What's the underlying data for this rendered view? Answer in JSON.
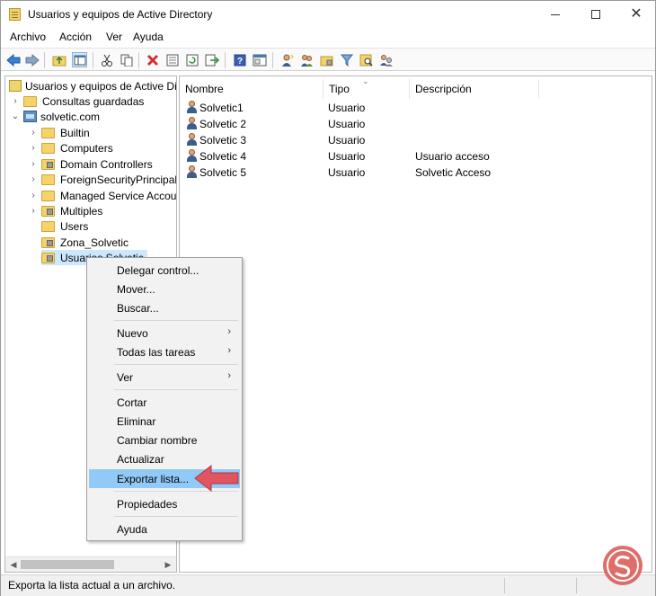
{
  "window": {
    "title": "Usuarios y equipos de Active Directory"
  },
  "menubar": {
    "items": [
      "Archivo",
      "Acción",
      "Ver",
      "Ayuda"
    ]
  },
  "tree": {
    "root": "Usuarios y equipos de Active Directory",
    "saved_queries": "Consultas guardadas",
    "domain": "solvetic.com",
    "children": [
      "Builtin",
      "Computers",
      "Domain Controllers",
      "ForeignSecurityPrincipals",
      "Managed Service Accounts",
      "Multiples",
      "Users",
      "Zona_Solvetic",
      "Usuarios Solvetic"
    ]
  },
  "list": {
    "columns": [
      "Nombre",
      "Tipo",
      "Descripción"
    ],
    "rows": [
      {
        "name": "Solvetic1",
        "type": "Usuario",
        "description": ""
      },
      {
        "name": "Solvetic 2",
        "type": "Usuario",
        "description": ""
      },
      {
        "name": "Solvetic 3",
        "type": "Usuario",
        "description": ""
      },
      {
        "name": "Solvetic 4",
        "type": "Usuario",
        "description": "Usuario acceso"
      },
      {
        "name": "Solvetic 5",
        "type": "Usuario",
        "description": "Solvetic Acceso"
      }
    ]
  },
  "context_menu": {
    "items": [
      {
        "label": "Delegar control...",
        "submenu": false
      },
      {
        "label": "Mover...",
        "submenu": false
      },
      {
        "label": "Buscar...",
        "submenu": false
      },
      {
        "label": "Nuevo",
        "submenu": true
      },
      {
        "label": "Todas las tareas",
        "submenu": true
      },
      {
        "label": "Ver",
        "submenu": true
      },
      {
        "label": "Cortar",
        "submenu": false
      },
      {
        "label": "Eliminar",
        "submenu": false
      },
      {
        "label": "Cambiar nombre",
        "submenu": false
      },
      {
        "label": "Actualizar",
        "submenu": false
      },
      {
        "label": "Exportar lista...",
        "submenu": false,
        "highlighted": true
      },
      {
        "label": "Propiedades",
        "submenu": false
      },
      {
        "label": "Ayuda",
        "submenu": false
      }
    ]
  },
  "statusbar": {
    "text": "Exporta la lista actual a un archivo."
  },
  "colors": {
    "highlight": "#91c9f7",
    "selection": "#cce8ff",
    "arrow": "#e0555f"
  },
  "icons": {
    "toolbar": [
      "back-icon",
      "forward-icon",
      "up-folder-icon",
      "show-hide-tree-icon",
      "cut-icon",
      "copy-icon",
      "delete-icon",
      "properties-icon",
      "refresh-icon",
      "export-icon",
      "help-icon",
      "console-icon",
      "new-user-icon",
      "new-group-icon",
      "new-ou-icon",
      "filter-icon",
      "find-icon",
      "add-to-group-icon"
    ]
  }
}
